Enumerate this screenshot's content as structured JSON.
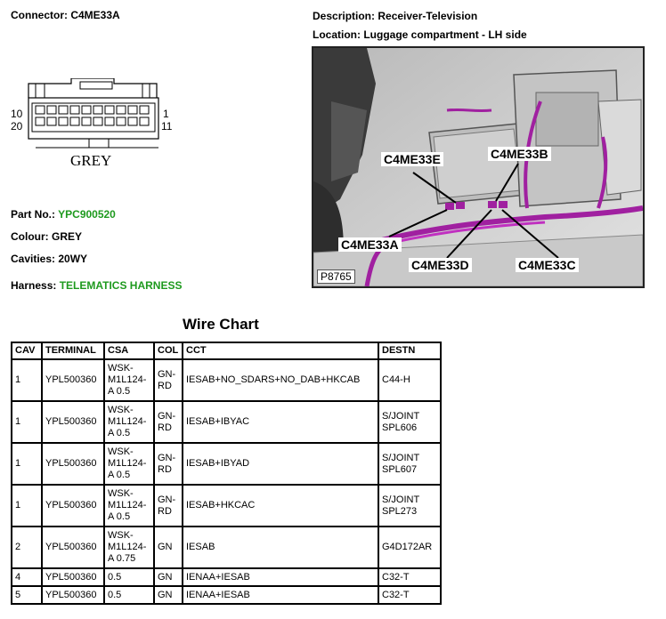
{
  "connector": {
    "label": "Connector:",
    "value": "C4ME33A",
    "pin_top_left": "10",
    "pin_bottom_left": "20",
    "pin_top_right": "1",
    "pin_bottom_right": "11",
    "housing_colour": "GREY"
  },
  "description": {
    "label": "Description:",
    "value": "Receiver-Television"
  },
  "location": {
    "label": "Location:",
    "value": "Luggage compartment - LH side"
  },
  "part_no": {
    "label": "Part No.:",
    "value": "YPC900520",
    "color": "#1e9a1e"
  },
  "colour": {
    "label": "Colour:",
    "value": "GREY"
  },
  "cavities": {
    "label": "Cavities:",
    "value": "20WY"
  },
  "harness": {
    "label": "Harness:",
    "value": "TELEMATICS HARNESS",
    "color": "#1e9a1e"
  },
  "photo": {
    "ref": "P8765",
    "callouts": {
      "e": "C4ME33E",
      "b": "C4ME33B",
      "a": "C4ME33A",
      "d": "C4ME33D",
      "c": "C4ME33C"
    }
  },
  "wire_chart": {
    "title": "Wire Chart",
    "headers": [
      "CAV",
      "TERMINAL",
      "CSA",
      "COL",
      "CCT",
      "DESTN"
    ],
    "rows": [
      [
        "1",
        "YPL500360",
        "WSK-M1L124-A 0.5",
        "GN-RD",
        "IESAB+NO_SDARS+NO_DAB+HKCAB",
        "C44-H"
      ],
      [
        "1",
        "YPL500360",
        "WSK-M1L124-A 0.5",
        "GN-RD",
        "IESAB+IBYAC",
        "S/JOINT SPL606"
      ],
      [
        "1",
        "YPL500360",
        "WSK-M1L124-A 0.5",
        "GN-RD",
        "IESAB+IBYAD",
        "S/JOINT SPL607"
      ],
      [
        "1",
        "YPL500360",
        "WSK-M1L124-A 0.5",
        "GN-RD",
        "IESAB+HKCAC",
        "S/JOINT SPL273"
      ],
      [
        "2",
        "YPL500360",
        "WSK-M1L124-A 0.75",
        "GN",
        "IESAB",
        "G4D172AR"
      ],
      [
        "4",
        "YPL500360",
        "0.5",
        "GN",
        "IENAA+IESAB",
        "C32-T"
      ],
      [
        "5",
        "YPL500360",
        "0.5",
        "GN",
        "IENAA+IESAB",
        "C32-T"
      ]
    ]
  }
}
